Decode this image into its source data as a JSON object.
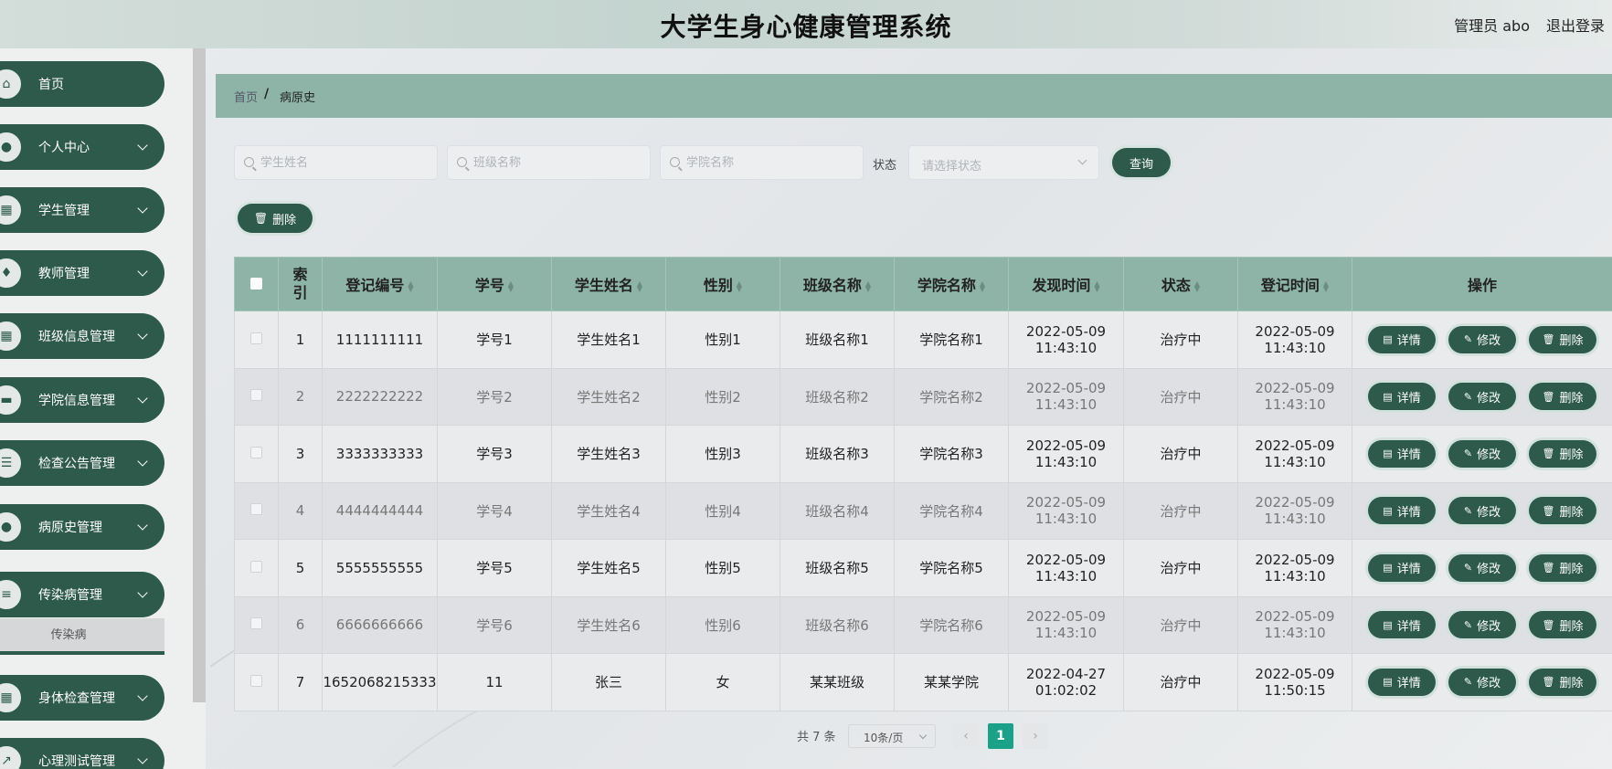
{
  "header": {
    "title": "大学生身心健康管理系统",
    "admin": "管理员 abo",
    "logout": "退出登录"
  },
  "sidebar": {
    "items": [
      {
        "label": "首页",
        "icon": "home-icon",
        "chevron": false
      },
      {
        "label": "个人中心",
        "icon": "user-icon",
        "chevron": true
      },
      {
        "label": "学生管理",
        "icon": "grid-icon",
        "chevron": true
      },
      {
        "label": "教师管理",
        "icon": "bulb-icon",
        "chevron": true
      },
      {
        "label": "班级信息管理",
        "icon": "grid-icon",
        "chevron": true
      },
      {
        "label": "学院信息管理",
        "icon": "briefcase-icon",
        "chevron": true
      },
      {
        "label": "检查公告管理",
        "icon": "sliders-icon",
        "chevron": true
      },
      {
        "label": "病原史管理",
        "icon": "user-icon",
        "chevron": true
      },
      {
        "label": "传染病管理",
        "icon": "list-icon",
        "chevron": true
      },
      {
        "label": "身体检查管理",
        "icon": "grid-icon",
        "chevron": true
      },
      {
        "label": "心理测试管理",
        "icon": "chart-icon",
        "chevron": true
      }
    ],
    "submenu_label": "传染病"
  },
  "breadcrumb": {
    "home": "首页",
    "separator": "/",
    "current": "病原史"
  },
  "search": {
    "student_name_placeholder": "学生姓名",
    "class_name_placeholder": "班级名称",
    "college_name_placeholder": "学院名称",
    "status_label": "状态",
    "status_placeholder": "请选择状态",
    "query_button": "查询",
    "delete_button": "删除"
  },
  "table": {
    "headers": [
      "索引",
      "登记编号",
      "学号",
      "学生姓名",
      "性别",
      "班级名称",
      "学院名称",
      "发现时间",
      "状态",
      "登记时间",
      "操作"
    ],
    "rows": [
      {
        "index": "1",
        "reg_no": "1111111111",
        "student_no": "学号1",
        "name": "学生姓名1",
        "gender": "性别1",
        "class": "班级名称1",
        "college": "学院名称1",
        "found_time": "2022-05-09 11:43:10",
        "status": "治疗中",
        "reg_time": "2022-05-09 11:43:10"
      },
      {
        "index": "2",
        "reg_no": "2222222222",
        "student_no": "学号2",
        "name": "学生姓名2",
        "gender": "性别2",
        "class": "班级名称2",
        "college": "学院名称2",
        "found_time": "2022-05-09 11:43:10",
        "status": "治疗中",
        "reg_time": "2022-05-09 11:43:10"
      },
      {
        "index": "3",
        "reg_no": "3333333333",
        "student_no": "学号3",
        "name": "学生姓名3",
        "gender": "性别3",
        "class": "班级名称3",
        "college": "学院名称3",
        "found_time": "2022-05-09 11:43:10",
        "status": "治疗中",
        "reg_time": "2022-05-09 11:43:10"
      },
      {
        "index": "4",
        "reg_no": "4444444444",
        "student_no": "学号4",
        "name": "学生姓名4",
        "gender": "性别4",
        "class": "班级名称4",
        "college": "学院名称4",
        "found_time": "2022-05-09 11:43:10",
        "status": "治疗中",
        "reg_time": "2022-05-09 11:43:10"
      },
      {
        "index": "5",
        "reg_no": "5555555555",
        "student_no": "学号5",
        "name": "学生姓名5",
        "gender": "性别5",
        "class": "班级名称5",
        "college": "学院名称5",
        "found_time": "2022-05-09 11:43:10",
        "status": "治疗中",
        "reg_time": "2022-05-09 11:43:10"
      },
      {
        "index": "6",
        "reg_no": "6666666666",
        "student_no": "学号6",
        "name": "学生姓名6",
        "gender": "性别6",
        "class": "班级名称6",
        "college": "学院名称6",
        "found_time": "2022-05-09 11:43:10",
        "status": "治疗中",
        "reg_time": "2022-05-09 11:43:10"
      },
      {
        "index": "7",
        "reg_no": "1652068215333",
        "student_no": "11",
        "name": "张三",
        "gender": "女",
        "class": "某某班级",
        "college": "某某学院",
        "found_time": "2022-04-27 01:02:02",
        "status": "治疗中",
        "reg_time": "2022-05-09 11:50:15"
      }
    ],
    "actions": {
      "detail": "详情",
      "edit": "修改",
      "delete": "删除"
    }
  },
  "pagination": {
    "total": "共 7 条",
    "page_size": "10条/页",
    "current_page": "1",
    "prev": "‹",
    "next": "›"
  },
  "colors": {
    "primary": "#2d5a4b",
    "header_bar": "#8db4a7",
    "page_active": "#1aa188"
  }
}
